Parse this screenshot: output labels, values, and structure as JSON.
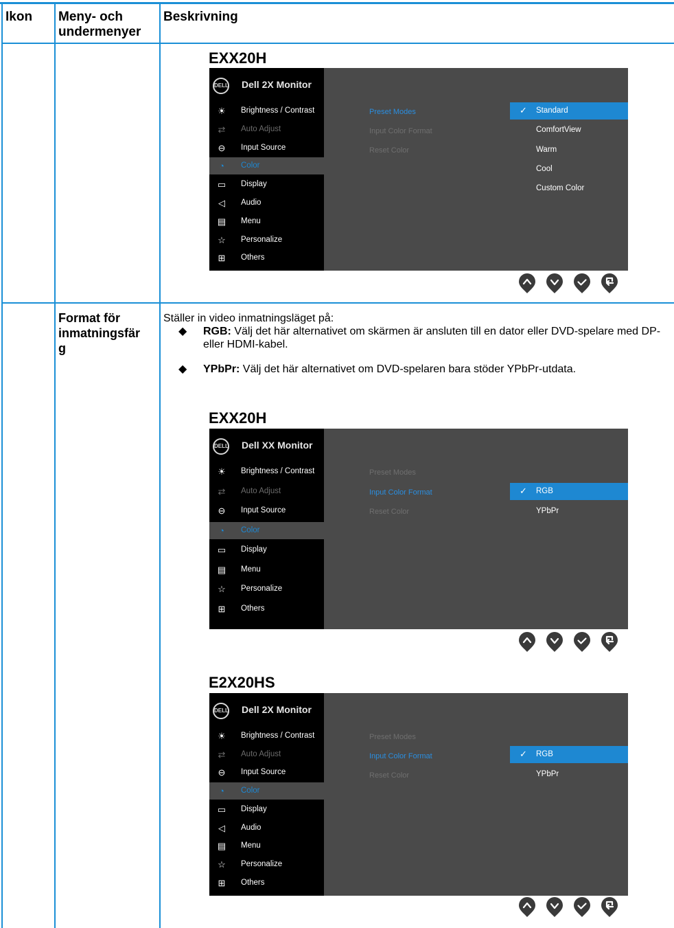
{
  "header": {
    "col1": "Ikon",
    "col2": "Meny- och undermenyer",
    "col3": "Beskrivning"
  },
  "row2": {
    "menu_label": "Format för inmatningsfär g",
    "intro": "Ställer in video inmatningsläget på:",
    "bullets": [
      {
        "term": "RGB:",
        "text": "Välj det här alternativet om skärmen är ansluten till en dator eller DVD-spelare med DP- eller HDMI-kabel."
      },
      {
        "term": "YPbPr:",
        "text": "Välj det här alternativet om DVD-spelaren bara stöder YPbPr-utdata."
      }
    ]
  },
  "osd1": {
    "model": "EXX20H",
    "logo": "DELL",
    "title": "Dell 2X Monitor",
    "menu": [
      {
        "icon": "sun-icon",
        "glyph": "☀",
        "label": "Brightness / Contrast",
        "state": "normal"
      },
      {
        "icon": "auto-adjust-icon",
        "glyph": "⇄",
        "label": "Auto Adjust",
        "state": "dim"
      },
      {
        "icon": "input-source-icon",
        "glyph": "⊖",
        "label": "Input Source",
        "state": "normal"
      },
      {
        "icon": "color-icon",
        "glyph": "◔",
        "label": "Color",
        "state": "selected"
      },
      {
        "icon": "display-icon",
        "glyph": "▭",
        "label": "Display",
        "state": "normal"
      },
      {
        "icon": "audio-icon",
        "glyph": "◁",
        "label": "Audio",
        "state": "normal"
      },
      {
        "icon": "menu-icon",
        "glyph": "▤",
        "label": "Menu",
        "state": "normal"
      },
      {
        "icon": "star-icon",
        "glyph": "☆",
        "label": "Personalize",
        "state": "normal"
      },
      {
        "icon": "others-icon",
        "glyph": "⊞",
        "label": "Others",
        "state": "normal"
      }
    ],
    "submenu": [
      {
        "label": "Preset Modes",
        "active": true
      },
      {
        "label": "Input Color Format",
        "active": false
      },
      {
        "label": "Reset Color",
        "active": false
      }
    ],
    "options": [
      {
        "label": "Standard",
        "selected": true
      },
      {
        "label": "ComfortView",
        "selected": false
      },
      {
        "label": "Warm",
        "selected": false
      },
      {
        "label": "Cool",
        "selected": false
      },
      {
        "label": "Custom Color",
        "selected": false
      }
    ]
  },
  "osd2": {
    "model": "EXX20H",
    "logo": "DELL",
    "title": "Dell XX Monitor",
    "menu": [
      {
        "icon": "sun-icon",
        "glyph": "☀",
        "label": "Brightness / Contrast",
        "state": "normal"
      },
      {
        "icon": "auto-adjust-icon",
        "glyph": "⇄",
        "label": "Auto Adjust",
        "state": "dim"
      },
      {
        "icon": "input-source-icon",
        "glyph": "⊖",
        "label": "Input Source",
        "state": "normal"
      },
      {
        "icon": "color-icon",
        "glyph": "◔",
        "label": "Color",
        "state": "selected"
      },
      {
        "icon": "display-icon",
        "glyph": "▭",
        "label": "Display",
        "state": "normal"
      },
      {
        "icon": "menu-icon",
        "glyph": "▤",
        "label": "Menu",
        "state": "normal"
      },
      {
        "icon": "star-icon",
        "glyph": "☆",
        "label": "Personalize",
        "state": "normal"
      },
      {
        "icon": "others-icon",
        "glyph": "⊞",
        "label": "Others",
        "state": "normal"
      }
    ],
    "submenu": [
      {
        "label": "Preset Modes",
        "active": false
      },
      {
        "label": "Input Color Format",
        "active": true
      },
      {
        "label": "Reset Color",
        "active": false
      }
    ],
    "options": [
      {
        "label": "RGB",
        "selected": true
      },
      {
        "label": "YPbPr",
        "selected": false
      }
    ]
  },
  "osd3": {
    "model": "E2X20HS",
    "logo": "DELL",
    "title": "Dell 2X Monitor",
    "menu": [
      {
        "icon": "sun-icon",
        "glyph": "☀",
        "label": "Brightness / Contrast",
        "state": "normal"
      },
      {
        "icon": "auto-adjust-icon",
        "glyph": "⇄",
        "label": "Auto Adjust",
        "state": "dim"
      },
      {
        "icon": "input-source-icon",
        "glyph": "⊖",
        "label": "Input Source",
        "state": "normal"
      },
      {
        "icon": "color-icon",
        "glyph": "◔",
        "label": "Color",
        "state": "selected"
      },
      {
        "icon": "display-icon",
        "glyph": "▭",
        "label": "Display",
        "state": "normal"
      },
      {
        "icon": "audio-icon",
        "glyph": "◁",
        "label": "Audio",
        "state": "normal"
      },
      {
        "icon": "menu-icon",
        "glyph": "▤",
        "label": "Menu",
        "state": "normal"
      },
      {
        "icon": "star-icon",
        "glyph": "☆",
        "label": "Personalize",
        "state": "normal"
      },
      {
        "icon": "others-icon",
        "glyph": "⊞",
        "label": "Others",
        "state": "normal"
      }
    ],
    "submenu": [
      {
        "label": "Preset Modes",
        "active": false
      },
      {
        "label": "Input Color Format",
        "active": true
      },
      {
        "label": "Reset Color",
        "active": false
      }
    ],
    "options": [
      {
        "label": "RGB",
        "selected": true
      },
      {
        "label": "YPbPr",
        "selected": false
      }
    ]
  },
  "nav_buttons": [
    {
      "icon": "up-arrow-icon",
      "glyph": "^"
    },
    {
      "icon": "down-arrow-icon",
      "glyph": "v"
    },
    {
      "icon": "checkmark-icon",
      "glyph": "✓"
    },
    {
      "icon": "back-icon",
      "glyph": "↶"
    }
  ],
  "colors": {
    "table_border": "#1a8fd6",
    "osd_panel": "#4a4a4a",
    "osd_sidebar": "#000000",
    "highlight": "#1e88d2",
    "nav_button": "#3a3a3a"
  }
}
